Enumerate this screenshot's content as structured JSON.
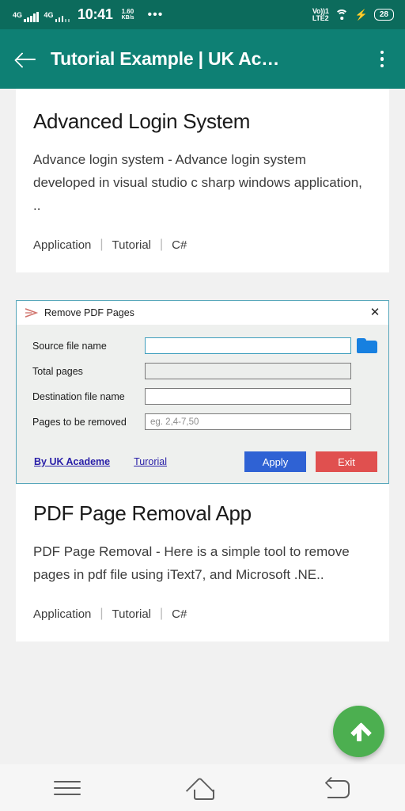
{
  "statusbar": {
    "network_type_1": "4G",
    "network_type_2": "4G",
    "time": "10:41",
    "net_speed_value": "1.60",
    "net_speed_unit": "KB/s",
    "more_icon": "•••",
    "volte_top": "Vo))1",
    "volte_bottom": "LTE2",
    "battery_percent": "28",
    "charging_icon": "⚡"
  },
  "appbar": {
    "title": "Tutorial Example | UK Ac…",
    "back_label": "Back",
    "menu_label": "More options"
  },
  "posts": [
    {
      "title": "Advanced Login System",
      "description": "Advance login system - Advance login system developed in visual studio c sharp windows application, ..",
      "tags": [
        "Application",
        "Tutorial",
        "C#"
      ]
    },
    {
      "title": "PDF Page Removal App",
      "description": "PDF Page Removal - Here is a simple tool to remove pages in pdf file using iText7, and Microsoft .NE..",
      "tags": [
        "Application",
        "Tutorial",
        "C#"
      ]
    }
  ],
  "tag_separator": "|",
  "winform": {
    "title": "Remove PDF Pages",
    "close_label": "✕",
    "fields": [
      {
        "label": "Source file name",
        "value": "",
        "placeholder": ""
      },
      {
        "label": "Total pages",
        "value": "",
        "placeholder": ""
      },
      {
        "label": "Destination file name",
        "value": "",
        "placeholder": ""
      },
      {
        "label": "Pages to be removed",
        "value": "",
        "placeholder": "eg. 2,4-7,50"
      }
    ],
    "links": [
      {
        "label": "By UK Academe"
      },
      {
        "label": "Turorial"
      }
    ],
    "buttons": [
      {
        "label": "Apply",
        "color": "#2f62d4"
      },
      {
        "label": "Exit",
        "color": "#e0504f"
      }
    ]
  },
  "fab": {
    "label": "Scroll to top"
  },
  "navbar": {
    "recents_label": "Recent apps",
    "home_label": "Home",
    "back_label": "Back"
  },
  "colors": {
    "statusbar_bg": "#0c6b5c",
    "appbar_bg": "#0e8074",
    "page_bg": "#f1f1f1",
    "card_bg": "#ffffff",
    "fab_bg": "#4caf50",
    "dialog_border": "#57a7bb",
    "link": "#2a20a8"
  }
}
